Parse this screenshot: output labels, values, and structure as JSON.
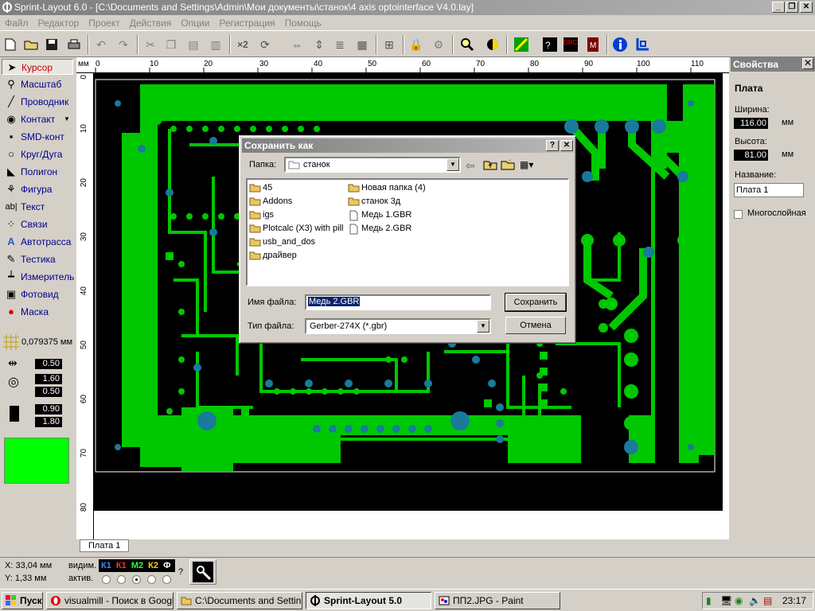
{
  "window": {
    "title": "Sprint-Layout 6.0 - [C:\\Documents and Settings\\Admin\\Мои документы\\станок\\4 axis optointerface V4.0.lay]"
  },
  "menu": [
    "Файл",
    "Редактор",
    "Проект",
    "Действия",
    "Опции",
    "Регистрация",
    "Помощь"
  ],
  "toolbar": {
    "multiply_label": "×2"
  },
  "tools": [
    {
      "label": "Курсор",
      "icon": "cursor-icon"
    },
    {
      "label": "Масштаб",
      "icon": "zoom-icon"
    },
    {
      "label": "Проводник",
      "icon": "track-icon"
    },
    {
      "label": "Контакт",
      "icon": "pad-icon"
    },
    {
      "label": "SMD-конт",
      "icon": "smd-icon"
    },
    {
      "label": "Круг/Дуга",
      "icon": "circle-icon"
    },
    {
      "label": "Полигон",
      "icon": "polygon-icon"
    },
    {
      "label": "Фигура",
      "icon": "shape-icon"
    },
    {
      "label": "Текст",
      "icon": "text-icon"
    },
    {
      "label": "Связи",
      "icon": "connections-icon"
    },
    {
      "label": "Автотрасса",
      "icon": "autoroute-icon"
    },
    {
      "label": "Тестика",
      "icon": "test-icon"
    },
    {
      "label": "Измеритель",
      "icon": "measure-icon"
    },
    {
      "label": "Фотовид",
      "icon": "photoview-icon"
    },
    {
      "label": "Маска",
      "icon": "mask-icon"
    }
  ],
  "grid": {
    "value": "0,079375 мм"
  },
  "sizes": {
    "track_width": "0.50",
    "pad_outer": "1.60",
    "pad_inner": "0.50",
    "smd_width": "0.90",
    "smd_height": "1.80"
  },
  "colors": {
    "current_layer": "#00ff00",
    "board": "#000000",
    "copper": "#00c800",
    "pads": "#1a7a9a"
  },
  "ruler": {
    "unit": "мм",
    "top": [
      "0",
      "10",
      "20",
      "30",
      "40",
      "50",
      "60",
      "70",
      "80",
      "90",
      "100",
      "110"
    ],
    "left": [
      "0",
      "10",
      "20",
      "30",
      "40",
      "50",
      "60",
      "70",
      "80"
    ]
  },
  "board_tab": "Плата 1",
  "properties": {
    "title": "Свойства",
    "section": "Плата",
    "width_label": "Ширина:",
    "width_value": "116.00",
    "height_label": "Высота:",
    "height_value": "81.00",
    "unit": "мм",
    "name_label": "Название:",
    "name_value": "Плата 1",
    "multilayer_label": "Многослойная"
  },
  "status": {
    "x": "X:  33,04 мм",
    "y": "Y:   1,33 мм",
    "visible_label": "видим.",
    "active_label": "актив.",
    "layers": [
      "К1",
      "К1",
      "М2",
      "К2",
      "Ф"
    ],
    "help": "?"
  },
  "dialog": {
    "title": "Сохранить как",
    "folder_label": "Папка:",
    "folder_value": "станок",
    "files_col1": [
      "45",
      "Addons",
      "igs",
      "Plotcalc (X3) with pill",
      "usb_and_dos",
      "драйвер"
    ],
    "files_col2": [
      "Новая папка (4)",
      "станок 3д",
      "Медь  1.GBR",
      "Медь  2.GBR"
    ],
    "filename_label": "Имя файла:",
    "filename_value": "Медь  2.GBR",
    "filetype_label": "Тип файла:",
    "filetype_value": "Gerber-274X (*.gbr)",
    "save_button": "Сохранить",
    "cancel_button": "Отмена"
  },
  "taskbar": {
    "start": "Пуск",
    "tasks": [
      "visualmill - Поиск в Googl...",
      "C:\\Documents and Settin...",
      "Sprint-Layout 5.0",
      "ПП2.JPG - Paint"
    ],
    "clock": "23:17"
  }
}
